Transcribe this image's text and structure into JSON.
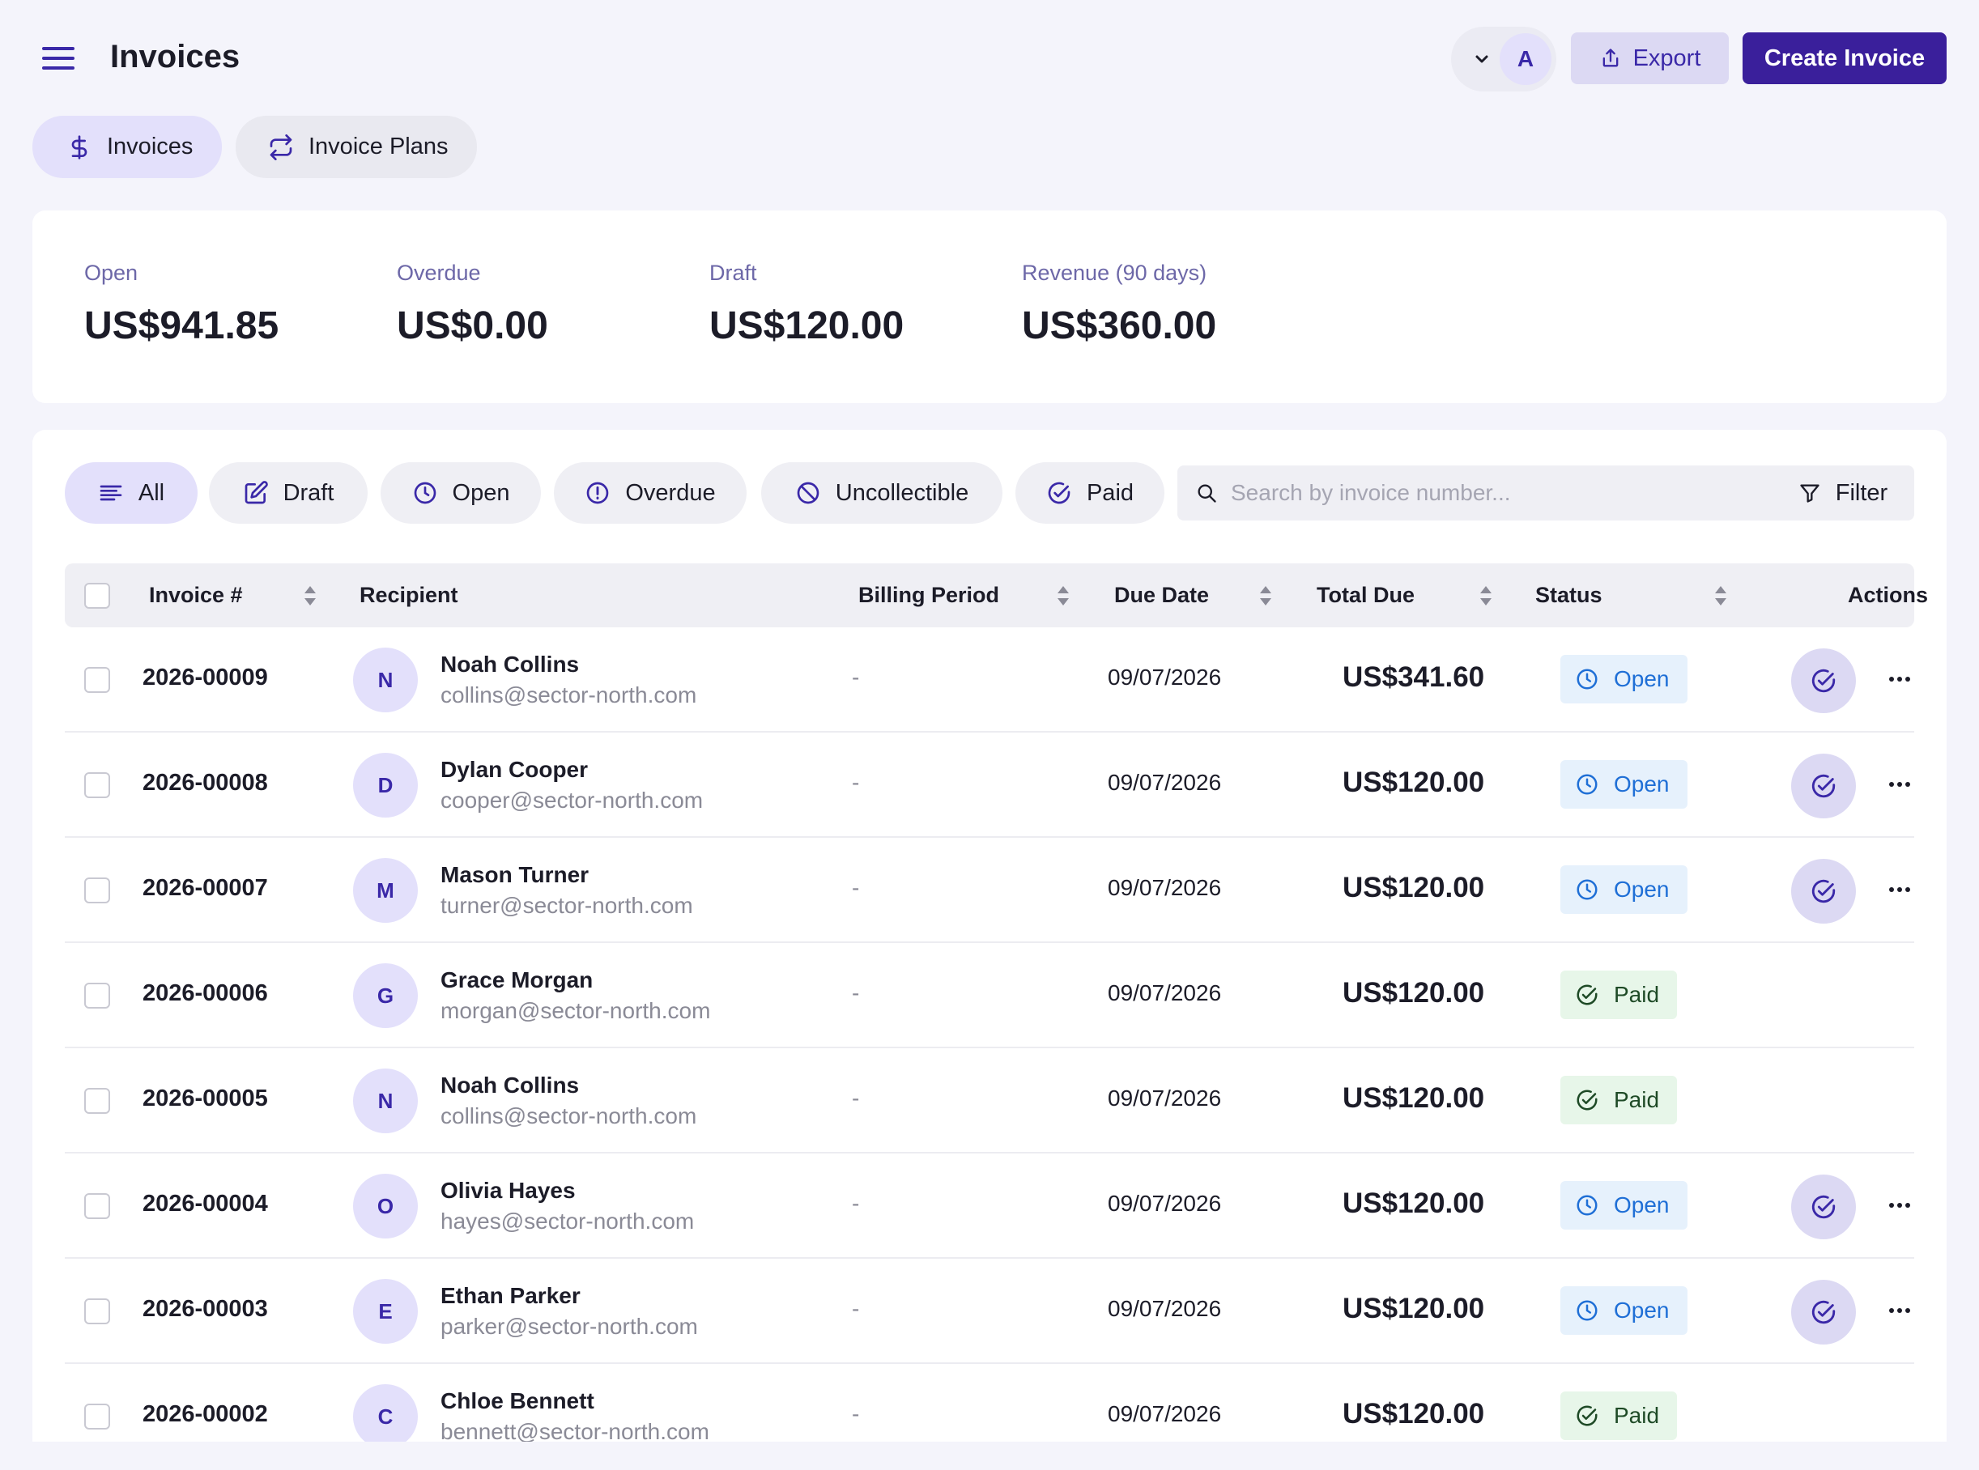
{
  "header": {
    "title": "Invoices",
    "account_initial": "A",
    "export_label": "Export",
    "create_label": "Create Invoice"
  },
  "tabs": [
    {
      "label": "Invoices",
      "icon": "dollar-icon",
      "active": true
    },
    {
      "label": "Invoice Plans",
      "icon": "repeat-icon",
      "active": false
    }
  ],
  "summary": [
    {
      "label": "Open",
      "value": "US$941.85"
    },
    {
      "label": "Overdue",
      "value": "US$0.00"
    },
    {
      "label": "Draft",
      "value": "US$120.00"
    },
    {
      "label": "Revenue (90 days)",
      "value": "US$360.00"
    }
  ],
  "filters": [
    {
      "label": "All",
      "icon": "list-icon",
      "active": true
    },
    {
      "label": "Draft",
      "icon": "edit-icon"
    },
    {
      "label": "Open",
      "icon": "clock-icon"
    },
    {
      "label": "Overdue",
      "icon": "alert-circle-icon"
    },
    {
      "label": "Uncollectible",
      "icon": "ban-icon"
    },
    {
      "label": "Paid",
      "icon": "check-circle-icon"
    }
  ],
  "search": {
    "placeholder": "Search by invoice number..."
  },
  "filter_label": "Filter",
  "columns": {
    "invoice": "Invoice #",
    "recipient": "Recipient",
    "billing": "Billing Period",
    "due": "Due Date",
    "total": "Total Due",
    "status": "Status",
    "actions": "Actions"
  },
  "rows": [
    {
      "number": "2026-00009",
      "initial": "N",
      "name": "Noah Collins",
      "email": "collins@sector-north.com",
      "billing": "-",
      "due": "09/07/2026",
      "total": "US$341.60",
      "status": "Open"
    },
    {
      "number": "2026-00008",
      "initial": "D",
      "name": "Dylan Cooper",
      "email": "cooper@sector-north.com",
      "billing": "-",
      "due": "09/07/2026",
      "total": "US$120.00",
      "status": "Open"
    },
    {
      "number": "2026-00007",
      "initial": "M",
      "name": "Mason Turner",
      "email": "turner@sector-north.com",
      "billing": "-",
      "due": "09/07/2026",
      "total": "US$120.00",
      "status": "Open"
    },
    {
      "number": "2026-00006",
      "initial": "G",
      "name": "Grace Morgan",
      "email": "morgan@sector-north.com",
      "billing": "-",
      "due": "09/07/2026",
      "total": "US$120.00",
      "status": "Paid"
    },
    {
      "number": "2026-00005",
      "initial": "N",
      "name": "Noah Collins",
      "email": "collins@sector-north.com",
      "billing": "-",
      "due": "09/07/2026",
      "total": "US$120.00",
      "status": "Paid"
    },
    {
      "number": "2026-00004",
      "initial": "O",
      "name": "Olivia Hayes",
      "email": "hayes@sector-north.com",
      "billing": "-",
      "due": "09/07/2026",
      "total": "US$120.00",
      "status": "Open"
    },
    {
      "number": "2026-00003",
      "initial": "E",
      "name": "Ethan Parker",
      "email": "parker@sector-north.com",
      "billing": "-",
      "due": "09/07/2026",
      "total": "US$120.00",
      "status": "Open"
    },
    {
      "number": "2026-00002",
      "initial": "C",
      "name": "Chloe Bennett",
      "email": "bennett@sector-north.com",
      "billing": "-",
      "due": "09/07/2026",
      "total": "US$120.00",
      "status": "Paid"
    }
  ],
  "colors": {
    "primary": "#3a1f9b",
    "accent_light": "#e3e0fb",
    "open_bg": "#e6f1fc",
    "open_text": "#1f6fd6",
    "paid_bg": "#e7f6e9",
    "paid_text": "#1e4a26"
  }
}
